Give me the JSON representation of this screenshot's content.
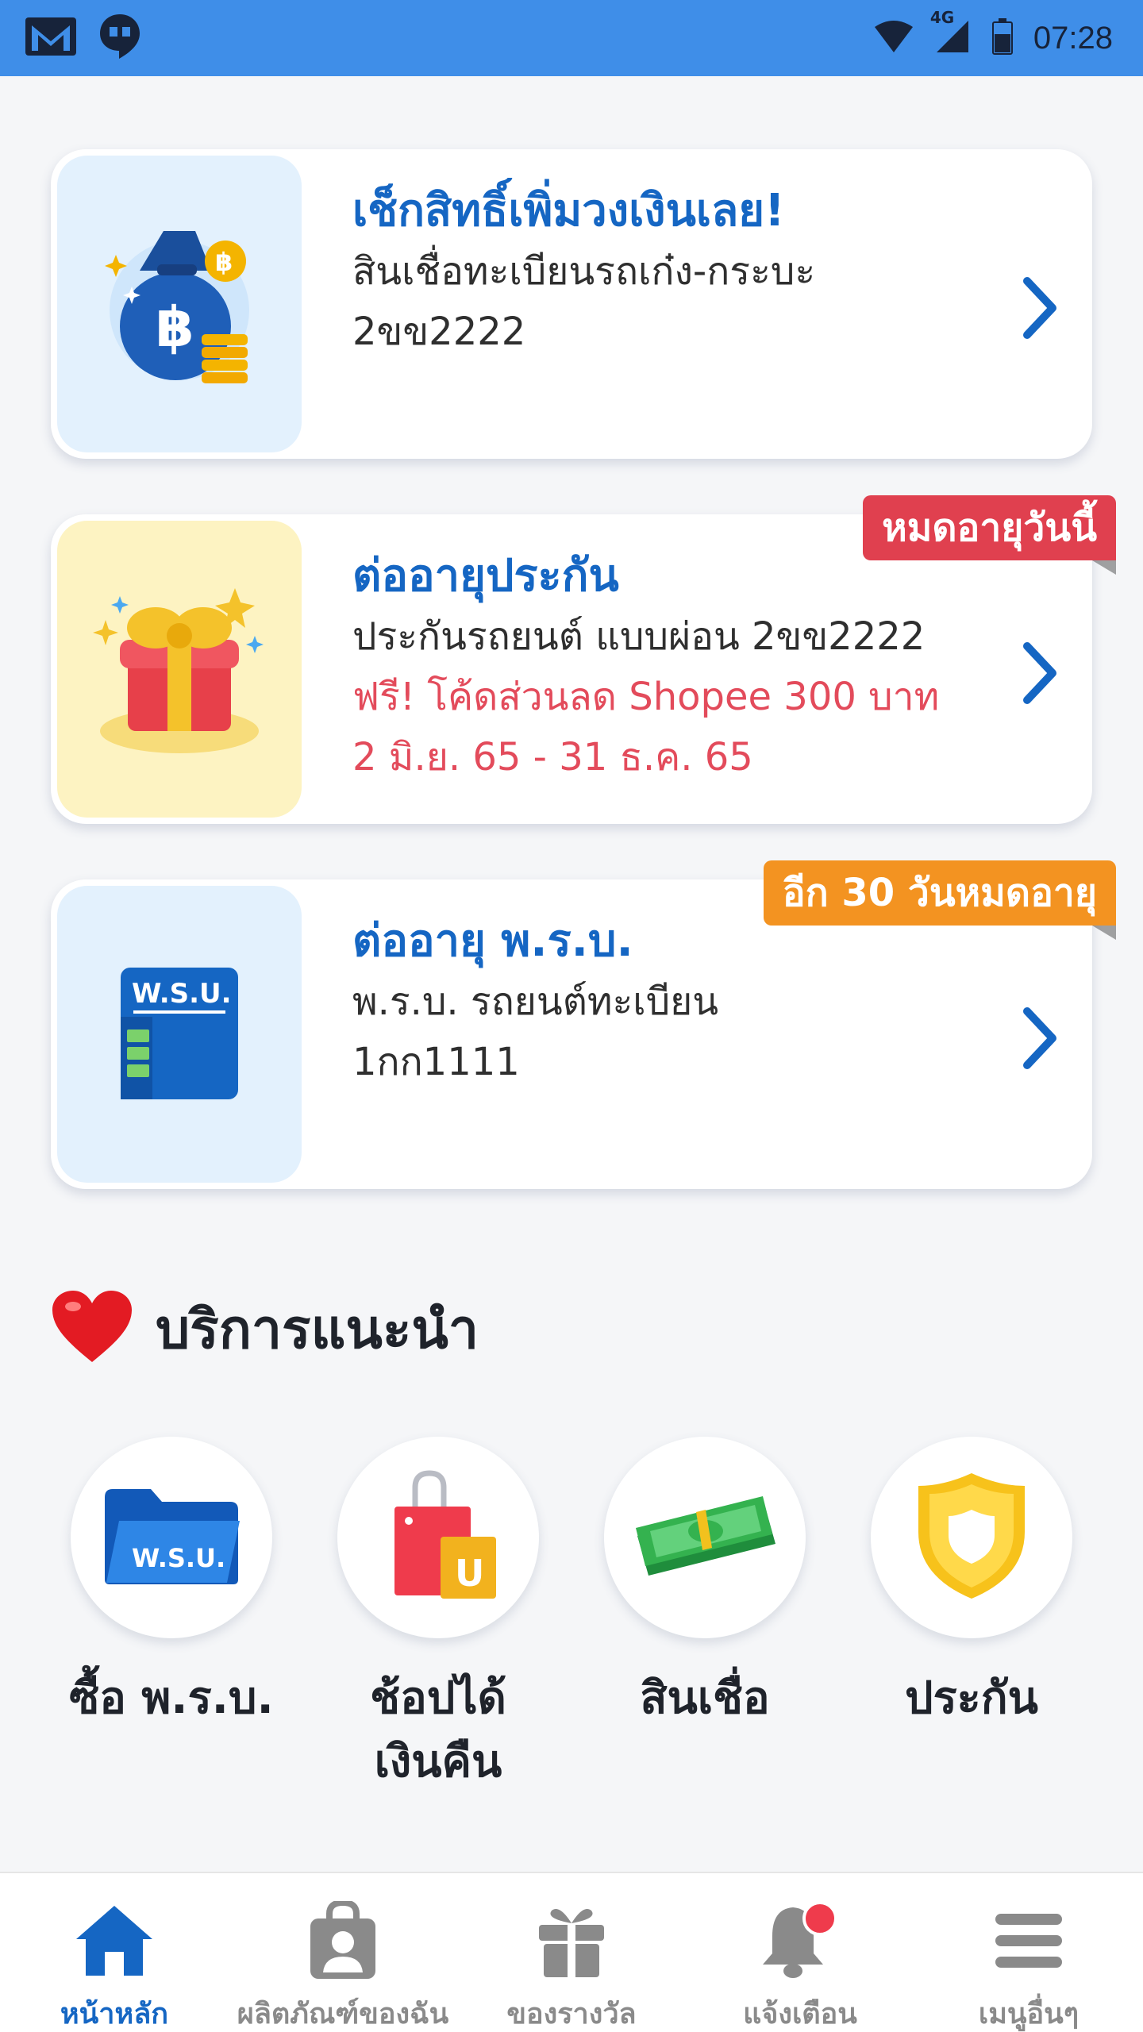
{
  "status_bar": {
    "time": "07:28",
    "network": "4G",
    "icons": [
      "gmail-icon",
      "hangouts-icon",
      "wifi-icon",
      "signal-icon",
      "battery-icon"
    ]
  },
  "cards": [
    {
      "title": "เช็กสิทธิ์เพิ่มวงเงินเลย!",
      "lines": [
        "สินเชื่อทะเบียนรถเก๋ง-กระบะ",
        "2ขข2222"
      ],
      "thumb_color": "#e3f1fd",
      "icon": "money-bag-icon"
    },
    {
      "title": "ต่ออายุประกัน",
      "lines": [
        "ประกันรถยนต์ แบบผ่อน 2ขข2222"
      ],
      "promo_lines": [
        "ฟรี! โค้ดส่วนลด Shopee 300 บาท",
        "2 มิ.ย. 65 - 31 ธ.ค. 65"
      ],
      "badge": "หมดอายุวันนี้",
      "badge_color": "#e0404f",
      "thumb_color": "#fdf3c2",
      "icon": "gift-icon"
    },
    {
      "title": "ต่ออายุ พ.ร.บ.",
      "lines": [
        "พ.ร.บ. รถยนต์ทะเบียน",
        "1กก1111"
      ],
      "badge": "อีก 30 วันหมดอายุ",
      "badge_color": "#f39321",
      "thumb_color": "#e3f1fd",
      "icon": "wsu-document-icon",
      "icon_text": "W.S.U."
    }
  ],
  "recommended": {
    "title": "บริการแนะนำ",
    "services": [
      {
        "label": "ซื้อ พ.ร.บ.",
        "icon": "wsu-folder-icon",
        "icon_text": "W.S.U."
      },
      {
        "label_lines": [
          "ช้อปได้",
          "เงินคืน"
        ],
        "icon": "shopping-bag-icon",
        "icon_text": "U"
      },
      {
        "label": "สินเชื่อ",
        "icon": "cash-stack-icon"
      },
      {
        "label": "ประกัน",
        "icon": "shield-icon"
      }
    ]
  },
  "bottom_nav": [
    {
      "label": "หน้าหลัก",
      "icon": "home-icon",
      "active": true
    },
    {
      "label": "ผลิตภัณฑ์ของฉัน",
      "icon": "my-products-icon"
    },
    {
      "label": "ของรางวัล",
      "icon": "gift-box-icon"
    },
    {
      "label": "แจ้งเตือน",
      "icon": "bell-icon",
      "has_dot": true
    },
    {
      "label": "เมนูอื่นๆ",
      "icon": "menu-icon"
    }
  ],
  "colors": {
    "accent": "#1566c3",
    "status_bar": "#3f8ee8",
    "promo_red": "#e34b5b",
    "nav_inactive": "#8a8a8a"
  }
}
